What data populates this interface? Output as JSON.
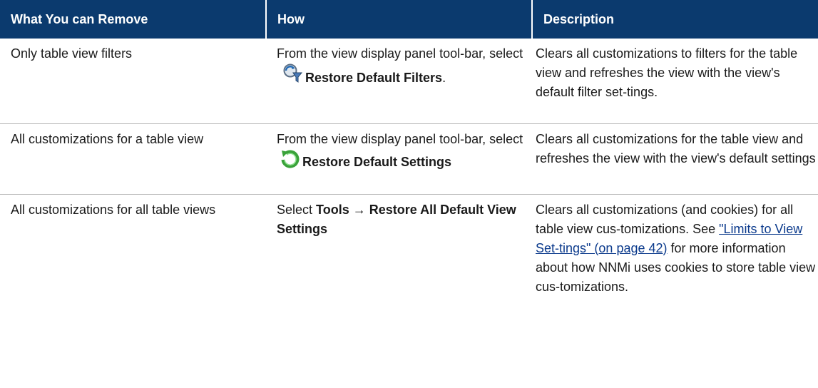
{
  "headers": [
    "What You can Remove",
    "How",
    "Description"
  ],
  "rows": [
    {
      "what": "Only table view filters",
      "how_prefix": "From the view display panel tool-bar, select",
      "how_bold": "Restore Default Filters",
      "how_suffix": ".",
      "icon": "restore-filters-icon",
      "description": "Clears all customizations to filters for the table view and refreshes the view with the view's default filter set-tings."
    },
    {
      "what": "All customizations for a table view",
      "how_prefix": "From the view display panel tool-bar, select",
      "how_bold": "Restore Default Settings",
      "how_suffix": "",
      "icon": "restore-settings-icon",
      "description": "Clears all customizations for the table view and refreshes the view with the view's default settings"
    },
    {
      "what": "All customizations for all table views",
      "how_prefix": "Select",
      "how_bold_1": "Tools",
      "arrow": "→",
      "how_bold_2": "Restore All Default View Settings",
      "desc_part1": "Clears all customizations (and cookies) for all table view cus-tomizations. See",
      "desc_link": "\"Limits to View Set-tings\" (on page 42)",
      "desc_part2": "for more information about how NNMi uses cookies to store table view cus-tomizations."
    }
  ],
  "colors": {
    "header_bg": "#0b3a6e",
    "header_text": "#ffffff",
    "link": "#0b3a8c",
    "row_border": "#b9b9b9"
  }
}
